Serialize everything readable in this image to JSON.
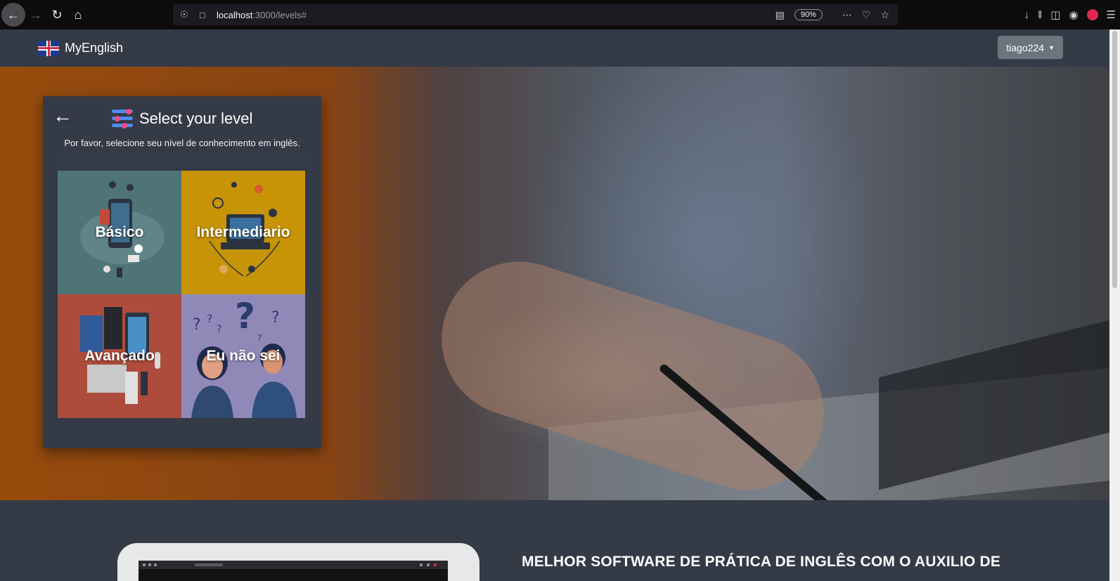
{
  "browser": {
    "url_host": "localhost",
    "url_path": ":3000/levels#",
    "zoom": "90%"
  },
  "navbar": {
    "brand": "MyEnglish",
    "user": "tiago224"
  },
  "card": {
    "title": "Select your level",
    "subtitle": "Por favor, selecione seu nível de conhecimento em inglês.",
    "levels": [
      {
        "label": "Básico"
      },
      {
        "label": "Intermediario"
      },
      {
        "label": "Avançado"
      },
      {
        "label": "Eu não sei"
      }
    ]
  },
  "lower": {
    "headline": "MELHOR SOFTWARE DE PRÁTICA DE INGLÊS COM O AUXILIO DE"
  },
  "icons": {
    "back": "arrow-left-icon",
    "forward": "arrow-right-icon",
    "reload": "reload-icon",
    "home": "home-icon",
    "shield": "shield-icon",
    "page": "page-icon",
    "reader": "reader-view-icon",
    "more": "more-icon",
    "pocket": "pocket-icon",
    "star": "bookmark-star-icon",
    "download": "download-icon",
    "library": "library-icon",
    "sidebar": "sidebar-icon",
    "account": "account-icon",
    "menu": "hamburger-menu-icon",
    "levels": "sliders-icon"
  },
  "colors": {
    "navbar": "#343a46",
    "tile_basico": "#4f7477",
    "tile_intermediario": "#c79307",
    "tile_avancado": "#ad4c3c",
    "tile_nao_sei": "#9089b8",
    "user_button": "#6c757d"
  }
}
